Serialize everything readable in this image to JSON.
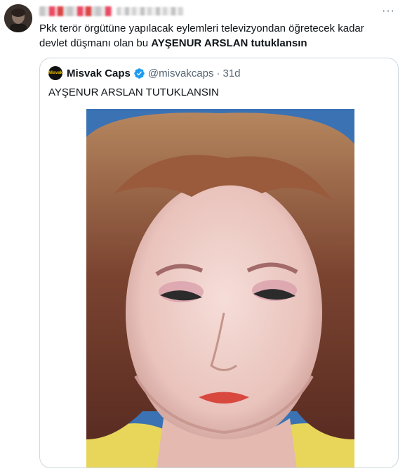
{
  "tweet": {
    "text_line1": "Pkk terör örgütüne yapılacak eylemleri televizyondan öğretecek kadar",
    "text_line2_plain": "devlet düşmanı olan bu ",
    "text_line2_bold": "AYŞENUR ARSLAN tutuklansın",
    "more_label": "···"
  },
  "quoted": {
    "avatar_text": "Misvak",
    "name": "Misvak Caps",
    "handle": "@misvakcaps",
    "separator": "·",
    "time": "31d",
    "text": "AYŞENUR ARSLAN TUTUKLANSIN"
  },
  "colors": {
    "text": "#0f1419",
    "secondary": "#536471",
    "verified": "#1d9bf0",
    "border": "#cfd9de"
  }
}
